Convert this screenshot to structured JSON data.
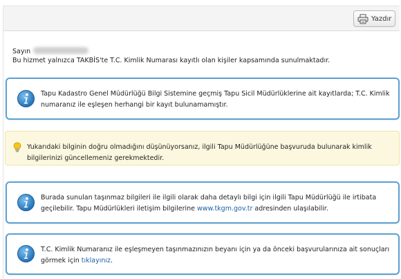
{
  "toolbar": {
    "print_label": "Yazdır",
    "print_icon": "printer-icon"
  },
  "greeting": {
    "salutation": "Sayın",
    "notice": "Bu hizmet yalnızca TAKBİS'te T.C. Kimlik Numarası kayıtlı olan kişiler kapsamında sunulmaktadır."
  },
  "box1": {
    "icon": "info-icon",
    "text": "Tapu Kadastro Genel Müdürlüğü Bilgi Sistemine geçmiş Tapu Sicil Müdürlüklerine ait kayıtlarda; T.C. Kimlik numaranız ile eşleşen herhangi bir kayıt bulunamamıştır."
  },
  "warning": {
    "icon": "lightbulb-icon",
    "text": "Yukarıdaki bilginin doğru olmadığını düşünüyorsanız, ilgili Tapu Müdürlüğüne başvuruda bulunarak kimlik bilgilerinizi güncellemeniz gerekmektedir."
  },
  "box2": {
    "icon": "info-icon",
    "text_before": "Burada sunulan taşınmaz bilgileri ile ilgili olarak daha detaylı bilgi için ilgili Tapu Müdürlüğü ile irtibata geçilebilir. Tapu Müdürlükleri iletişim bilgilerine ",
    "link": "www.tkgm.gov.tr",
    "text_after": " adresinden ulaşılabilir."
  },
  "box3": {
    "icon": "info-icon",
    "text_before": "T.C. Kimlik Numaranız ile eşleşmeyen taşınmazınızın beyanı için ya da önceki başvurularınıza ait sonuçları görmek için ",
    "link": "tıklayınız",
    "text_after": "."
  },
  "colors": {
    "accent_border": "#5aa0d2",
    "link": "#1d5fa3",
    "warning_bg": "#fcf8e0"
  }
}
